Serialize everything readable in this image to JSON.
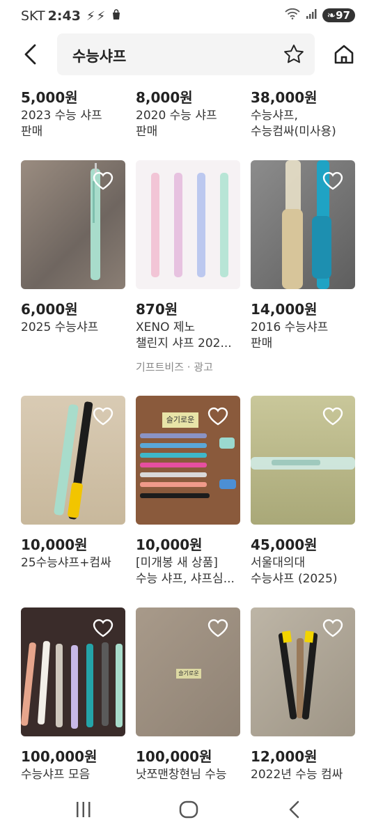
{
  "status": {
    "carrier": "SKT",
    "time": "2:43",
    "battery": "97"
  },
  "search": {
    "query": "수능샤프"
  },
  "top_row": [
    {
      "price": "5,000원",
      "title1": "2023 수능 샤프",
      "title2": "판매"
    },
    {
      "price": "8,000원",
      "title1": "2020 수능 샤프",
      "title2": "판매"
    },
    {
      "price": "38,000원",
      "title1": "수능샤프,",
      "title2": "수능컴싸(미사용)"
    }
  ],
  "items": [
    {
      "price": "6,000원",
      "title1": "2025 수능샤프",
      "title2": ""
    },
    {
      "price": "870원",
      "title1": "XENO 제노",
      "title2": "챌린지 샤프 202...",
      "ad": "기프트비즈 · 광고"
    },
    {
      "price": "14,000원",
      "title1": "2016 수능샤프",
      "title2": "판매"
    },
    {
      "price": "10,000원",
      "title1": "25수능샤프+컴싸",
      "title2": ""
    },
    {
      "price": "10,000원",
      "title1": "[미개봉 새 상품]",
      "title2": "수능 샤프, 샤프심..."
    },
    {
      "price": "45,000원",
      "title1": "서울대의대",
      "title2": "수능샤프 (2025)"
    },
    {
      "price": "100,000원",
      "title1": "수능샤프 모음",
      "title2": ""
    },
    {
      "price": "100,000원",
      "title1": "낫쪼맨창현님 수능",
      "title2": ""
    },
    {
      "price": "12,000원",
      "title1": "2022년 수능 컴싸",
      "title2": ""
    }
  ],
  "photo_text": {
    "sticky_note": "슬기로운",
    "note2": "슬기로운"
  },
  "colors": {
    "accent": "#222222",
    "muted": "#888888",
    "search_bg": "#f4f4f4"
  }
}
